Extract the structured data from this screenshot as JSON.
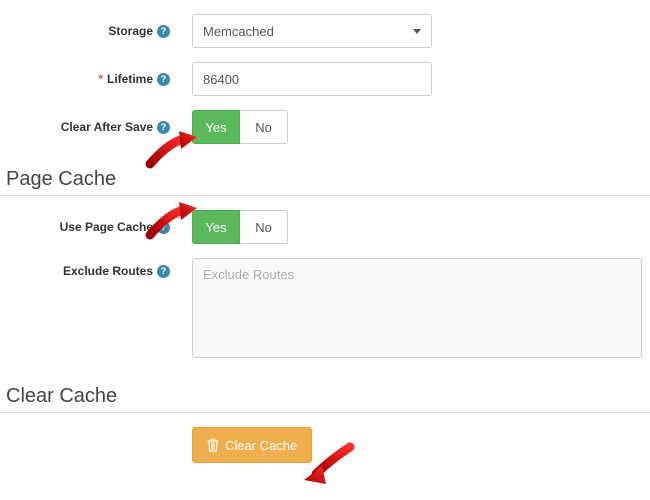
{
  "fields": {
    "storage": {
      "label": "Storage",
      "value": "Memcached"
    },
    "lifetime": {
      "label": "Lifetime",
      "required_marker": "*",
      "value": "86400"
    },
    "clear_after_save": {
      "label": "Clear After Save",
      "yes": "Yes",
      "no": "No",
      "selected": "yes"
    },
    "use_page_cache": {
      "label": "Use Page Cache",
      "yes": "Yes",
      "no": "No",
      "selected": "yes"
    },
    "exclude_routes": {
      "label": "Exclude Routes",
      "placeholder": "Exclude Routes"
    }
  },
  "sections": {
    "page_cache": "Page Cache",
    "clear_cache": "Clear Cache"
  },
  "actions": {
    "clear_cache_button": "Clear Cache"
  },
  "help_glyph": "?"
}
